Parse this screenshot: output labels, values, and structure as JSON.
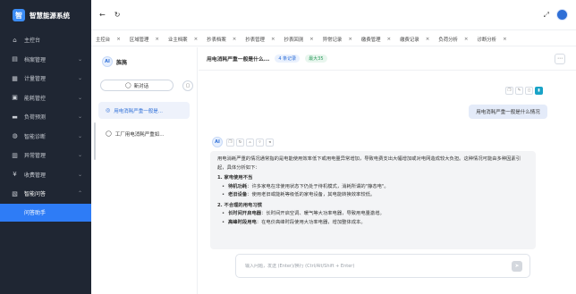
{
  "app": {
    "logo_char": "智",
    "title": "智慧能源系统"
  },
  "sidebar": {
    "items": [
      {
        "icon": "⌂",
        "label": "主控台",
        "arrow": ""
      },
      {
        "icon": "▤",
        "label": "档案管理",
        "arrow": "⌄"
      },
      {
        "icon": "▦",
        "label": "计量管理",
        "arrow": "⌄"
      },
      {
        "icon": "▣",
        "label": "能耗管控",
        "arrow": "⌄"
      },
      {
        "icon": "▬",
        "label": "负荷预测",
        "arrow": "⌄"
      },
      {
        "icon": "◍",
        "label": "智能诊断",
        "arrow": "⌄"
      },
      {
        "icon": "▥",
        "label": "异常管理",
        "arrow": "⌄"
      },
      {
        "icon": "¥",
        "label": "收费管理",
        "arrow": "⌄"
      },
      {
        "icon": "▧",
        "label": "智能问答",
        "arrow": "⌃"
      }
    ],
    "sub_active": "问答助手"
  },
  "topbar": {
    "back_icon": "←",
    "refresh_icon": "↻",
    "expand_icon": "⤢"
  },
  "tabs": [
    {
      "label": "主控台"
    },
    {
      "label": "区域管理"
    },
    {
      "label": "业主档案"
    },
    {
      "label": "抄表档案"
    },
    {
      "label": "抄表管理"
    },
    {
      "label": "抄表回测"
    },
    {
      "label": "异常记录"
    },
    {
      "label": "缴费管理"
    },
    {
      "label": "缴费记录"
    },
    {
      "label": "负荷分析"
    },
    {
      "label": "诊断分析"
    }
  ],
  "chat_list": {
    "logo": "AI",
    "title": "旌旄",
    "new_chat": "新对话",
    "conversations": [
      {
        "title": "用电消耗严重一般是..."
      },
      {
        "title": "工厂用电消耗严重如..."
      }
    ]
  },
  "chat": {
    "title": "用电消耗严重一般是什么...",
    "badge_records": "4 条记录",
    "badge_tokens": "最大35",
    "more": "⋯",
    "user_message": "用电消耗严重一般是什么情况",
    "answer": {
      "intro": "用电消耗严重的情况通常指的是电能使用效率低下或用电量异常增加，导致电费支出大幅增加或对电网造成较大负担。这种情况可能由多种因素引起，具体分析如下：",
      "section1_title": "1. 家电使用不当",
      "section1_items": [
        {
          "bold": "待机功耗",
          "text": "：许多家电在非使用状态下仍处于待机模式，消耗所谓的\"静态电\"。"
        },
        {
          "bold": "老旧设备",
          "text": "：使用老旧或能耗等级低的家电设备，其电能转换效率较低。"
        }
      ],
      "section2_title": "2. 不合理的用电习惯",
      "section2_items": [
        {
          "bold": "长时间开启电器",
          "text": "：长时间开启空调、暖气等大功率电器，导致用电量激增。"
        },
        {
          "bold": "高峰时段用电",
          "text": "：在电价高峰时段使用大功率电器，增加整体成本。"
        }
      ]
    },
    "input_placeholder": "输入问题，发送 (Enter)/换行 (Ctrl/Alt/Shift + Enter)",
    "send_icon": "➤"
  }
}
